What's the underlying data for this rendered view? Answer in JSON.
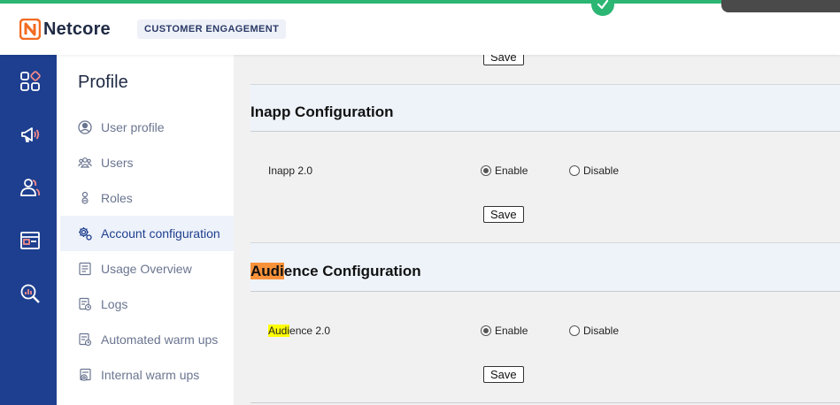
{
  "header": {
    "brand": "Netcore",
    "product_badge": "CUSTOMER ENGAGEMENT",
    "accent_color": "#2bb673",
    "brand_color": "#f26b21"
  },
  "rail": {
    "icons": [
      "dashboard-icon",
      "megaphone-icon",
      "audience-icon",
      "web-window-icon",
      "analytics-icon"
    ]
  },
  "sidenav": {
    "title": "Profile",
    "items": [
      {
        "label": "User profile",
        "icon": "user-circle-icon"
      },
      {
        "label": "Users",
        "icon": "users-icon"
      },
      {
        "label": "Roles",
        "icon": "roles-icon"
      },
      {
        "label": "Account configuration",
        "icon": "gear-icon",
        "active": true
      },
      {
        "label": "Usage Overview",
        "icon": "report-icon"
      },
      {
        "label": "Logs",
        "icon": "logs-icon"
      },
      {
        "label": "Automated warm ups",
        "icon": "warmup-icon"
      },
      {
        "label": "Internal warm ups",
        "icon": "internal-warmup-icon"
      }
    ]
  },
  "content": {
    "top_save_label": "Save",
    "inapp": {
      "title": "Inapp Configuration",
      "row_label": "Inapp 2.0",
      "enable_label": "Enable",
      "disable_label": "Disable",
      "selected": "Enable",
      "save_label": "Save"
    },
    "audience": {
      "title_highlight": "Audi",
      "title_rest": "ence Configuration",
      "row_label_highlight": "Audi",
      "row_label_rest": "ence 2.0",
      "enable_label": "Enable",
      "disable_label": "Disable",
      "selected": "Enable",
      "save_label": "Save"
    }
  }
}
